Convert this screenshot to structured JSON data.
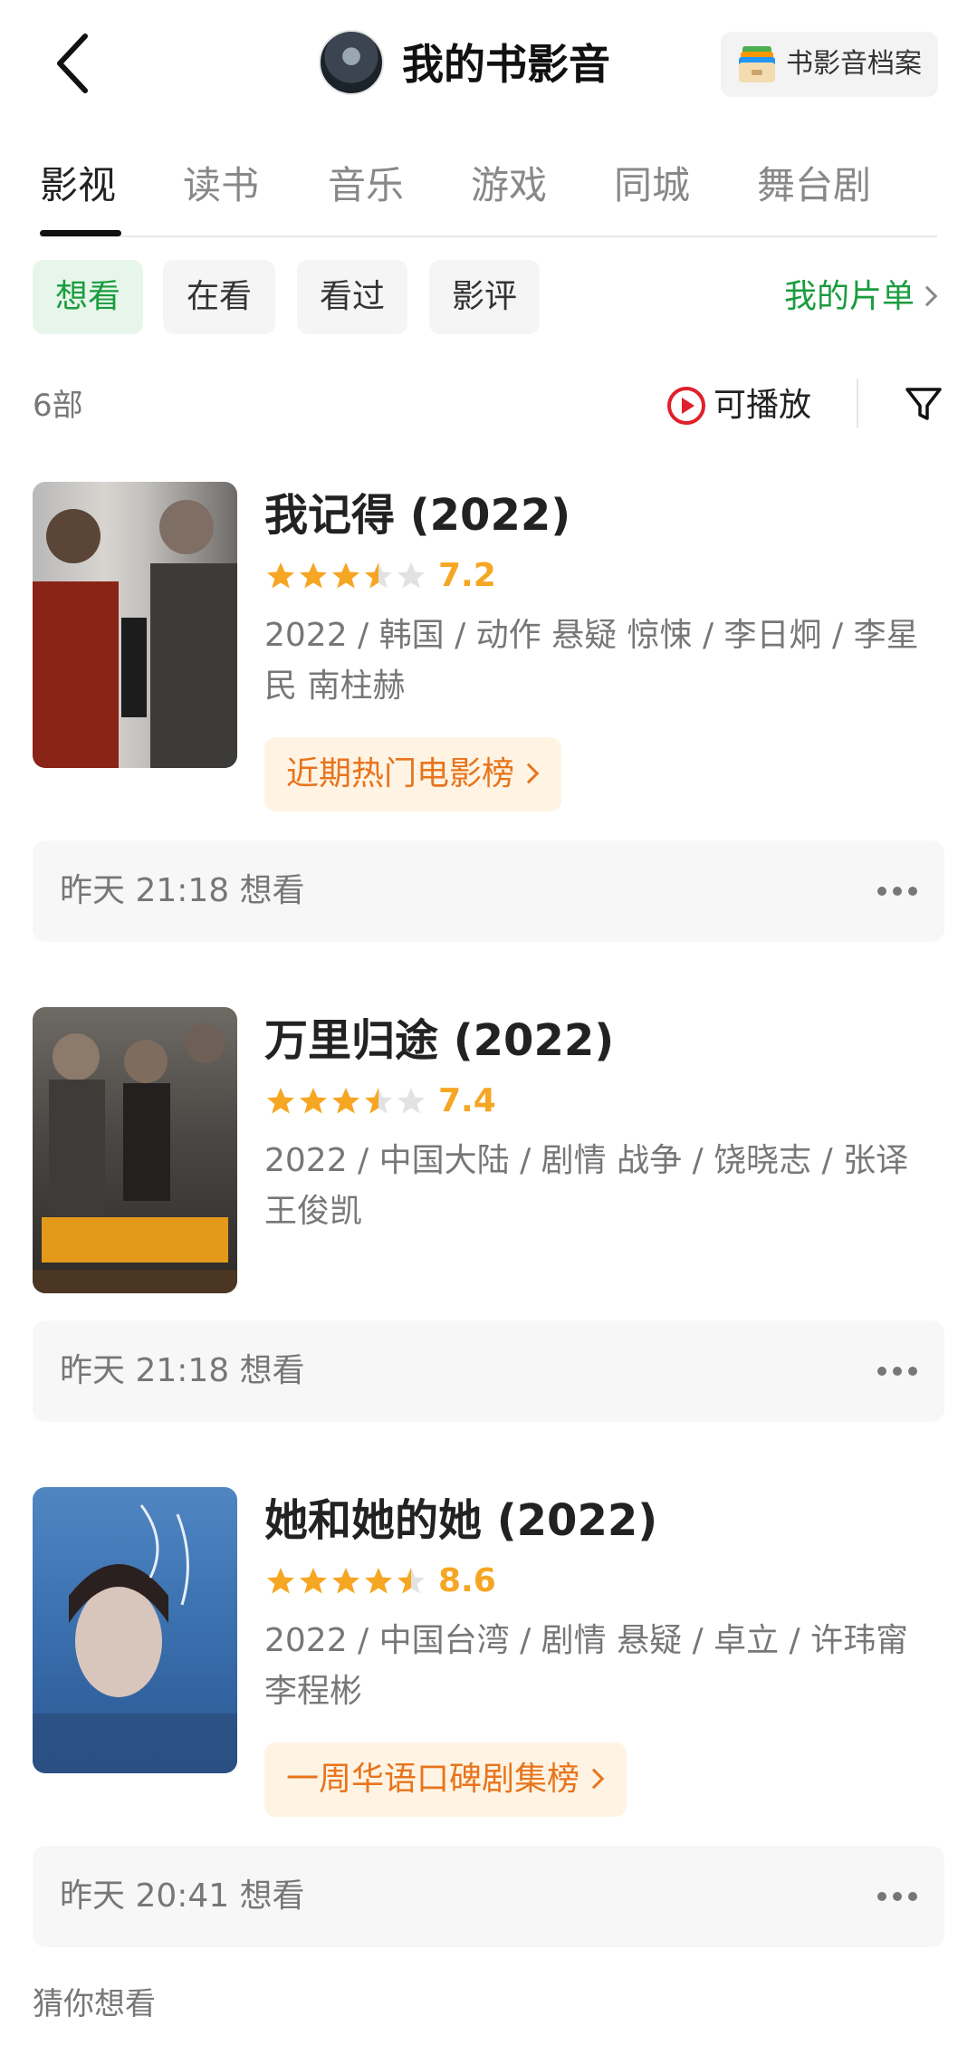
{
  "header": {
    "title": "我的书影音",
    "archive_label": "书影音档案",
    "back_icon": "back-arrow-icon",
    "archive_icon": "archive-box-icon"
  },
  "tabs": [
    "影视",
    "读书",
    "音乐",
    "游戏",
    "同城",
    "舞台剧"
  ],
  "active_tab": "影视",
  "filter_chips": [
    "想看",
    "在看",
    "看过",
    "影评"
  ],
  "active_chip": "想看",
  "my_list_label": "我的片单",
  "count_label": "6部",
  "playable_label": "可播放",
  "colors": {
    "accent_green": "#1a9c3e",
    "rating_orange": "#f5a623",
    "tag_orange": "#e8741c",
    "play_red": "#e0202c"
  },
  "movies": [
    {
      "title": "我记得 (2022)",
      "rating": "7.2",
      "rating_stars": 3.5,
      "meta": "2022 / 韩国 / 动作 悬疑 惊悚 / 李日炯 / 李星民 南柱赫",
      "rank_tag": "近期热门电影榜",
      "status": "昨天 21:18 想看"
    },
    {
      "title": "万里归途 (2022)",
      "rating": "7.4",
      "rating_stars": 3.5,
      "meta": "2022 / 中国大陆 / 剧情 战争 / 饶晓志 / 张译 王俊凯",
      "rank_tag": "",
      "status": "昨天 21:18 想看"
    },
    {
      "title": "她和她的她 (2022)",
      "rating": "8.6",
      "rating_stars": 4.5,
      "meta": "2022 / 中国台湾 / 剧情 悬疑 / 卓立 / 许玮甯 李程彬",
      "rank_tag": "一周华语口碑剧集榜",
      "status": "昨天 20:41 想看"
    }
  ],
  "guess_label": "猜你想看"
}
